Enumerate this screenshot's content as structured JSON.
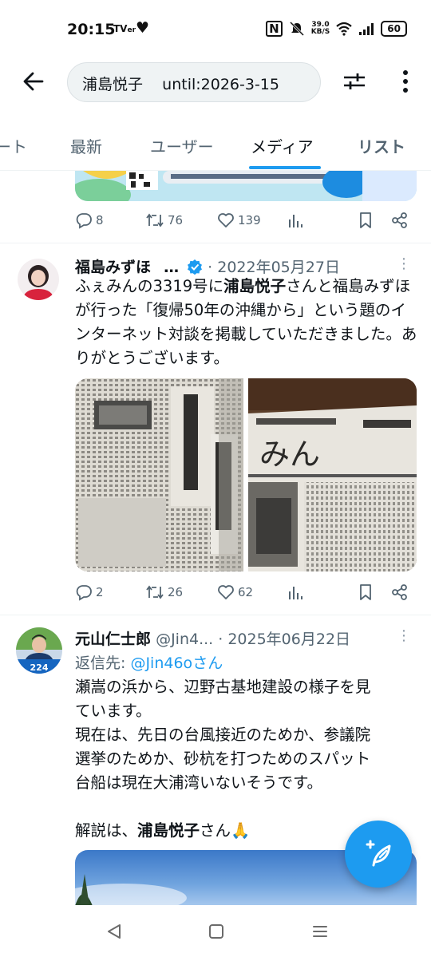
{
  "status_bar": {
    "time": "20:15",
    "tv_label": "TVer",
    "net_speed_value": "39.0",
    "net_speed_unit": "KB/S",
    "battery": "60"
  },
  "search": {
    "query": "浦島悦子    until:2026-3-15"
  },
  "tabs": [
    {
      "label": "ート"
    },
    {
      "label": "最新"
    },
    {
      "label": "ユーザー"
    },
    {
      "label": "メディア"
    },
    {
      "label": "リスト"
    }
  ],
  "prev_tweet": {
    "replies": "8",
    "retweets": "76",
    "likes": "139"
  },
  "tweet1": {
    "name": "福島みずほ",
    "date": "· 2022年05月27日",
    "text_1": "ふぇみんの3319号に",
    "text_bold": "浦島悦子",
    "text_2": "さんと福島みずほが行った「復帰50年の沖縄から」という題のインターネット対談を掲載していただきました。ありがとうございます。",
    "replies": "2",
    "retweets": "26",
    "likes": "62"
  },
  "tweet2": {
    "name": "元山仁士郎",
    "handle": "@Jin4...",
    "date": "· 2025年06月22日",
    "reply_prefix": "返信先: ",
    "reply_handle": "@Jin46o",
    "reply_suffix": "さん",
    "text_lines": [
      "瀬嵩の浜から、辺野古基地建設の様子を見",
      "ています。",
      "現在は、先日の台風接近のためか、参議院",
      "選挙のためか、砂杭を打つためのスパット",
      "台船は現在大浦湾いないそうです。"
    ],
    "text_last_1": "解説は、",
    "text_last_bold": "浦島悦子",
    "text_last_2": "さん🙏",
    "avatar_badge": "224"
  }
}
